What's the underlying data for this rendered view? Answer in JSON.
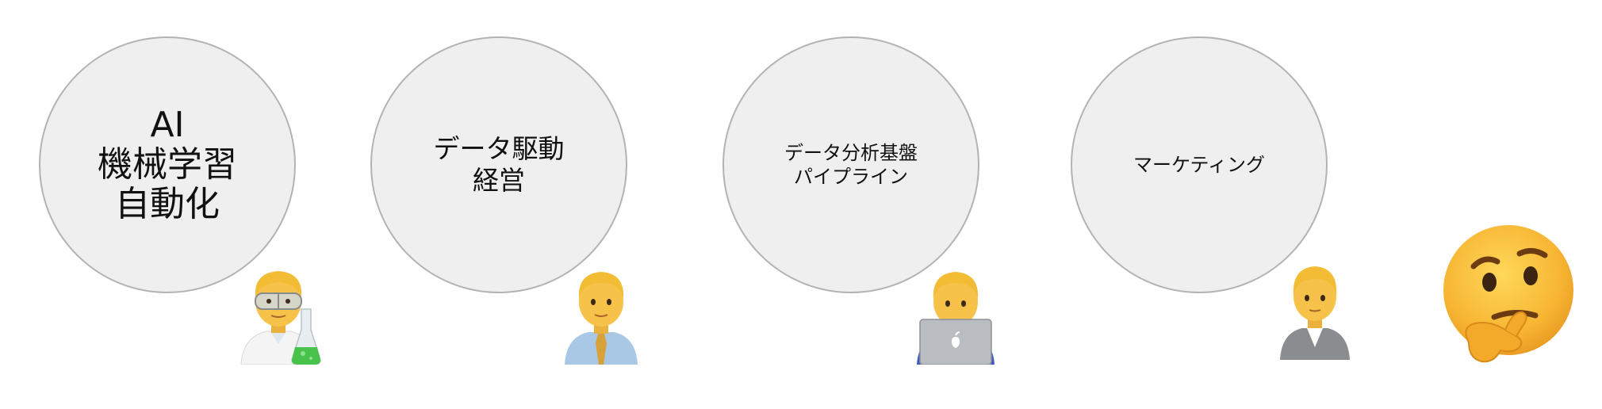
{
  "circles": [
    {
      "lines": [
        "AI",
        "機械学習",
        "自動化"
      ]
    },
    {
      "lines": [
        "データ駆動",
        "経営"
      ]
    },
    {
      "lines": [
        "データ分析基盤",
        "パイプライン"
      ]
    },
    {
      "lines": [
        "マーケティング"
      ]
    }
  ],
  "icons": {
    "person1": "scientist-icon",
    "person2": "businessman-icon",
    "person3": "technologist-icon",
    "person4": "office-worker-icon",
    "thinker": "thinking-face-icon"
  },
  "colors": {
    "circle_fill": "#efefef",
    "circle_border": "#b3b3b3",
    "skin": "#f7c24a",
    "hair": "#f3c240"
  }
}
